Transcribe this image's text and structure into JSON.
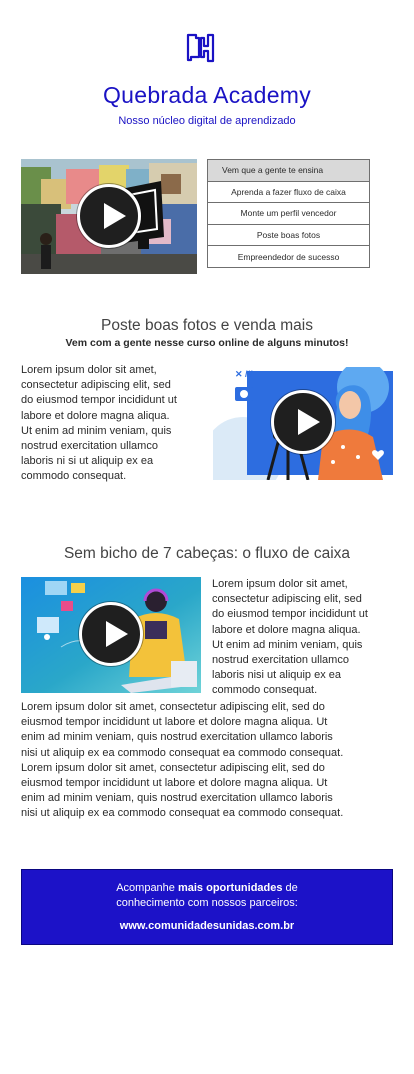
{
  "header": {
    "logo": "dh-logo-icon",
    "title": "Quebrada Academy",
    "subtitle": "Nosso núcleo digital de aprendizado"
  },
  "menu": {
    "items": [
      "Vem que a gente te ensina",
      "Aprenda a fazer fluxo de caixa",
      "Monte um perfil vencedor",
      "Poste boas fotos",
      "Empreendedor de sucesso"
    ]
  },
  "section1": {
    "title": "Poste boas fotos e venda mais",
    "subtitle": "Vem com a gente nesse curso online de alguns minutos!",
    "lines": [
      "Lorem ipsum dolor sit amet,",
      "consectetur adipiscing elit, sed",
      "do eiusmod tempor incididunt ut",
      "labore et dolore magna aliqua.",
      "Ut enim ad minim veniam, quis",
      "nostrud exercitation ullamco",
      "laboris ni  si ut aliquip ex ea",
      "commodo consequat."
    ]
  },
  "section2": {
    "title": "Sem bicho de 7 cabeças: o fluxo de caixa",
    "side_lines": [
      "Lorem ipsum dolor sit amet,",
      "consectetur adipiscing elit, sed",
      "do eiusmod tempor incididunt ut",
      "labore et dolore magna aliqua.",
      "Ut enim ad minim veniam, quis",
      "nostrud exercitation ullamco",
      "laboris nisi ut aliquip ex ea",
      "commodo consequat."
    ],
    "body_lines": [
      "Lorem ipsum dolor sit amet, consectetur adipiscing elit, sed do",
      "eiusmod tempor incididunt ut labore et dolore magna aliqua. Ut",
      "enim ad minim veniam, quis nostrud exercitation ullamco laboris",
      "nisi ut aliquip ex ea commodo consequat ea commodo consequat.",
      "Lorem ipsum dolor sit amet, consectetur adipiscing elit, sed do",
      "eiusmod tempor incididunt ut labore et dolore magna aliqua. Ut",
      "enim ad minim veniam, quis nostrud exercitation ullamco laboris",
      "nisi ut aliquip ex ea commodo consequat ea commodo consequat."
    ]
  },
  "banner": {
    "text_before": "Acompanhe ",
    "text_bold": "mais oportunidades",
    "text_after": " de",
    "text_line2": "conhecimento com nossos parceiros:",
    "link": "www.comunidadesunidas.com.br"
  },
  "colors": {
    "brand": "#1a12c4",
    "banner": "#1c12c8"
  }
}
